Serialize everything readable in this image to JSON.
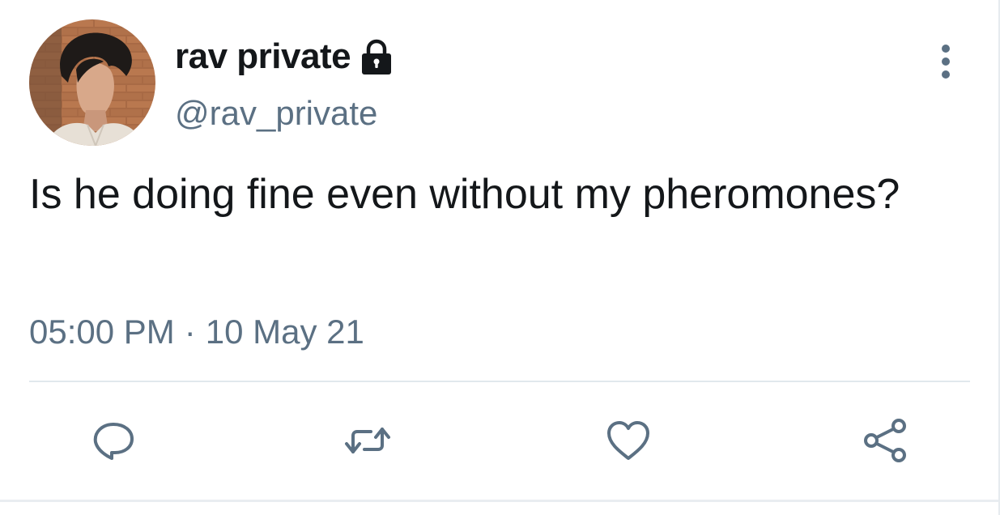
{
  "tweet": {
    "display_name": "rav private",
    "handle": "@rav_private",
    "text": "Is he doing fine even without my pheromones?",
    "time": "05:00 PM",
    "separator": "·",
    "date": "10 May 21"
  },
  "icons": {
    "lock": "lock-icon",
    "more": "more-vertical-icon",
    "reply": "reply-icon",
    "retweet": "retweet-icon",
    "like": "heart-icon",
    "share": "share-icon"
  },
  "colors": {
    "text_primary": "#14171a",
    "text_secondary": "#5b7083",
    "icon": "#5b7083",
    "divider": "#e1e8ed",
    "background": "#ffffff"
  }
}
